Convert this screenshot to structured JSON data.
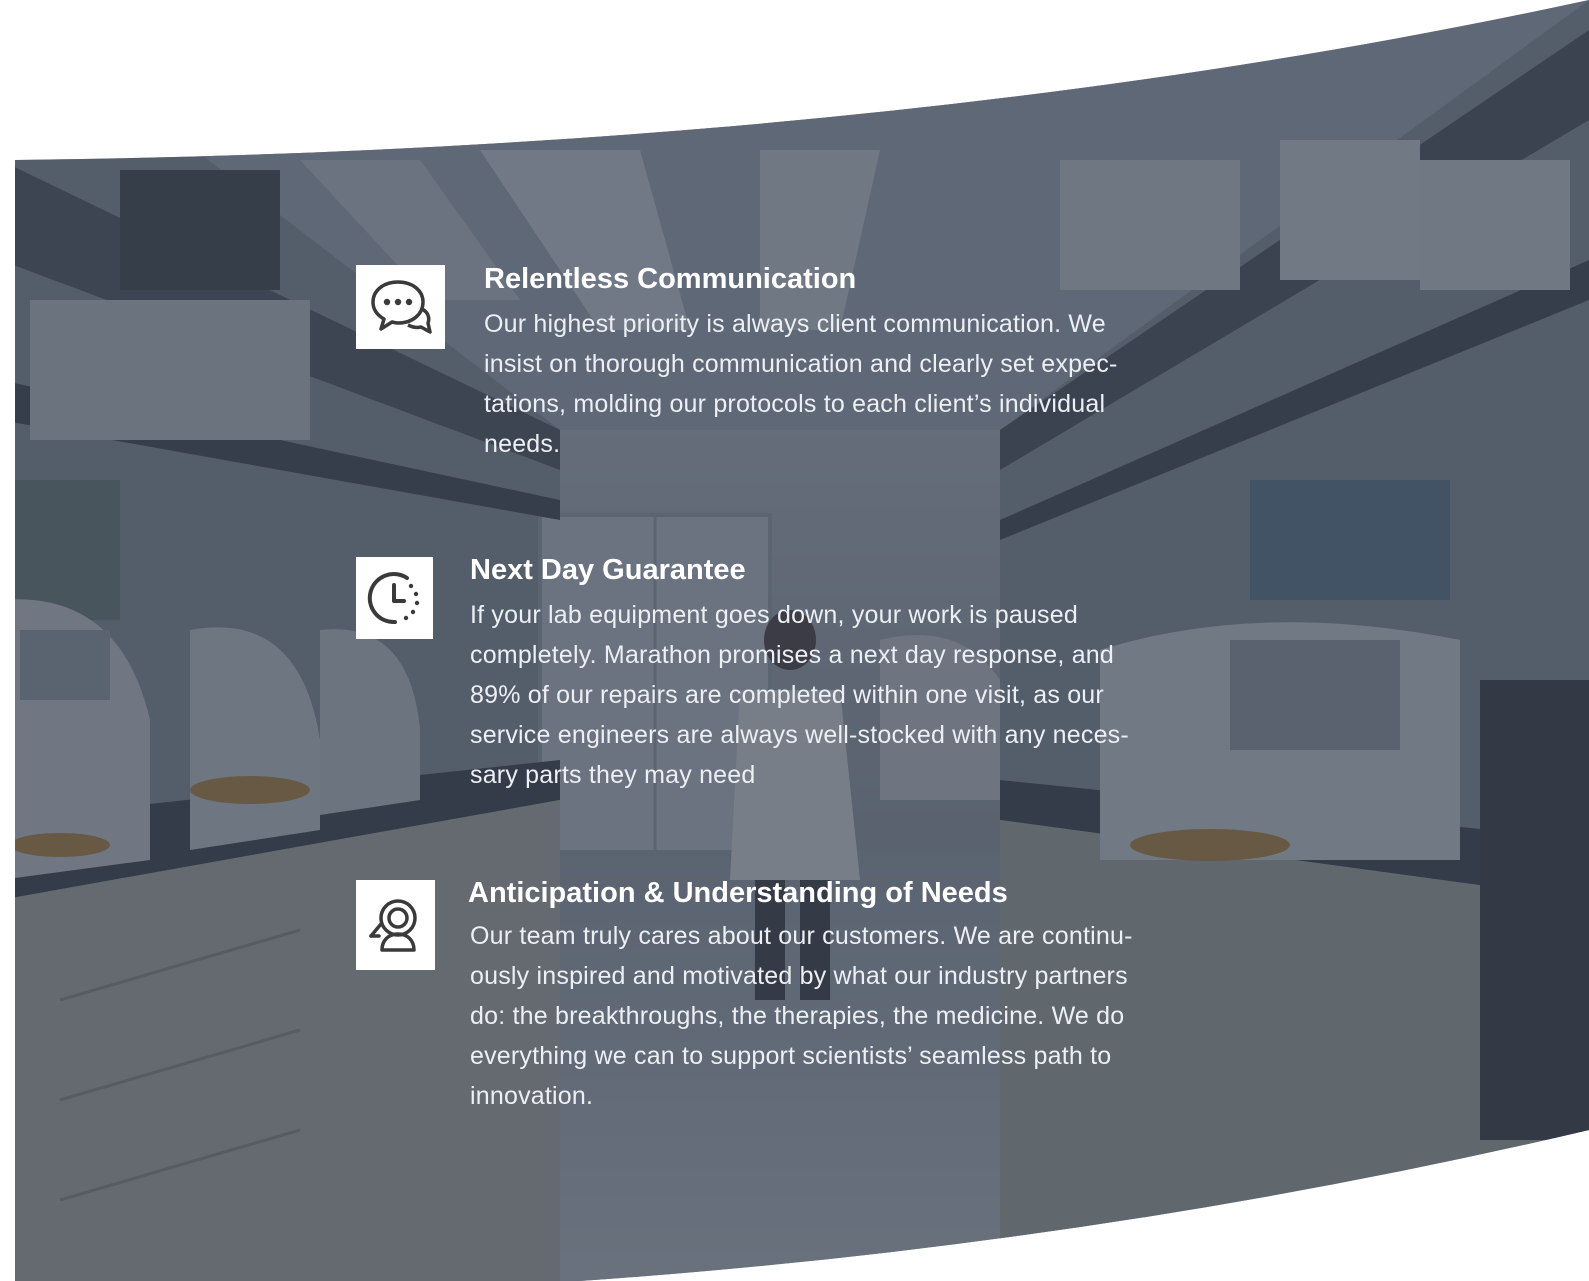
{
  "colors": {
    "overlay": "#3c4656",
    "icon_stroke": "#3a3a3a",
    "icon_bg": "#ffffff",
    "title_text": "#ffffff",
    "body_text": "#eceff3"
  },
  "features": [
    {
      "icon": "chat-bubbles-icon",
      "title": "Relentless Communication",
      "body_lines": [
        "Our highest priority is always client communication. We",
        "insist on thorough communication and clearly set expec-",
        "tations, molding our protocols to each client’s individual",
        "needs."
      ]
    },
    {
      "icon": "clock-icon",
      "title": "Next Day Guarantee",
      "body_lines": [
        "If your lab equipment goes down, your work is paused",
        "completely. Marathon promises a next day response, and",
        "89% of our repairs are completed within one visit, as our",
        "service engineers are always well-stocked with any neces-",
        "sary parts they may need"
      ]
    },
    {
      "icon": "person-support-icon",
      "title": "Anticipation & Understanding of Needs",
      "body_lines": [
        "Our team truly cares about our customers. We are continu-",
        "ously inspired and motivated by what our industry partners",
        "do: the breakthroughs, the therapies, the medicine. We do",
        "everything we can to support scientists’ seamless path to",
        "innovation."
      ]
    }
  ]
}
